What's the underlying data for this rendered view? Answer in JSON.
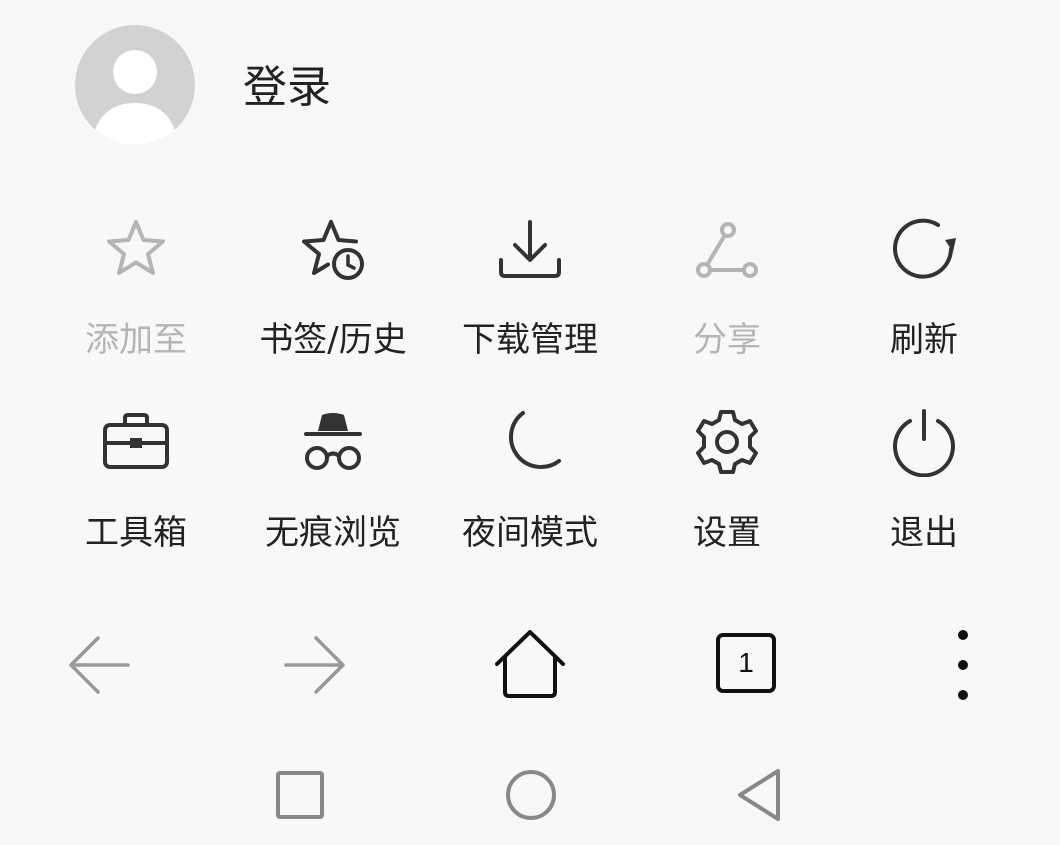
{
  "profile": {
    "login_label": "登录",
    "avatar_icon": "person-icon"
  },
  "menu": {
    "row1": [
      {
        "label": "添加至",
        "icon": "star-icon",
        "enabled": false
      },
      {
        "label": "书签/历史",
        "icon": "star-clock-icon",
        "enabled": true
      },
      {
        "label": "下载管理",
        "icon": "download-icon",
        "enabled": true
      },
      {
        "label": "分享",
        "icon": "share-icon",
        "enabled": false
      },
      {
        "label": "刷新",
        "icon": "refresh-icon",
        "enabled": true
      }
    ],
    "row2": [
      {
        "label": "工具箱",
        "icon": "toolbox-icon",
        "enabled": true
      },
      {
        "label": "无痕浏览",
        "icon": "incognito-icon",
        "enabled": true
      },
      {
        "label": "夜间模式",
        "icon": "moon-icon",
        "enabled": true
      },
      {
        "label": "设置",
        "icon": "gear-icon",
        "enabled": true
      },
      {
        "label": "退出",
        "icon": "power-icon",
        "enabled": true
      }
    ]
  },
  "navbar": {
    "tab_count": "1",
    "icons": [
      "back-arrow-icon",
      "forward-arrow-icon",
      "home-icon",
      "tabs-icon",
      "more-vertical-icon"
    ]
  },
  "system_nav": {
    "icons": [
      "recents-square-icon",
      "home-circle-icon",
      "back-triangle-icon"
    ]
  },
  "colors": {
    "background": "#f8f8f8",
    "text": "#222222",
    "disabled": "#b5b5b5",
    "avatar": "#d2d2d2"
  }
}
